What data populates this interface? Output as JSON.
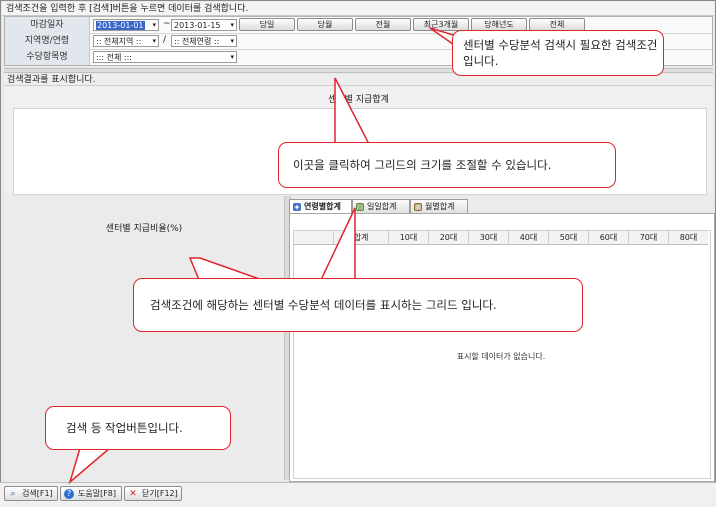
{
  "hint": "검색조건을 입력한 후 [검색]버튼을 누르면 데이터를 검색합니다.",
  "conditions": {
    "date_label": "마감일자",
    "date_from": "2013-01-01",
    "date_tilde": "~",
    "date_to": "2013-01-15",
    "period_buttons": [
      "당일",
      "당월",
      "전월",
      "최근3개월",
      "당해년도",
      "전체"
    ],
    "region_label": "지역명/연령",
    "region_select": ":: 전체지역 ::",
    "slash": "/",
    "age_select": ":: 전체연령 ::",
    "item_label": "수당항목명",
    "item_select": "::: 전체 :::"
  },
  "result_title": "검색결과를 표시합니다.",
  "summary_title": "센터별 지급합계",
  "pie_title": "센터별 지급비율(%)",
  "tabs": [
    {
      "label": "연령별합계",
      "icon": "age-tab-icon"
    },
    {
      "label": "일일합계",
      "icon": "daily-tab-icon"
    },
    {
      "label": "월별합계",
      "icon": "monthly-tab-icon"
    }
  ],
  "grid_columns": [
    "",
    "합계",
    "10대",
    "20대",
    "30대",
    "40대",
    "50대",
    "60대",
    "70대",
    "80대"
  ],
  "no_data": "표시할 데이터가 없습니다.",
  "bottom_buttons": {
    "search": "검색[F1]",
    "help": "도움말[F8]",
    "close": "닫기[F12]"
  },
  "callouts": {
    "conditions": "센터별 수당분석 검색시 필요한 검색조건입니다.",
    "resize": "이곳을 클릭하여 그리드의 크기를 조절할 수 있습니다.",
    "grid": "검색조건에 해당하는 센터별 수당분석 데이터를 표시하는 그리드 입니다.",
    "buttons": "검색 등 작업버튼입니다."
  },
  "colors": {
    "callout_border": "#e0252b",
    "date_highlight": "#3a67c9"
  }
}
